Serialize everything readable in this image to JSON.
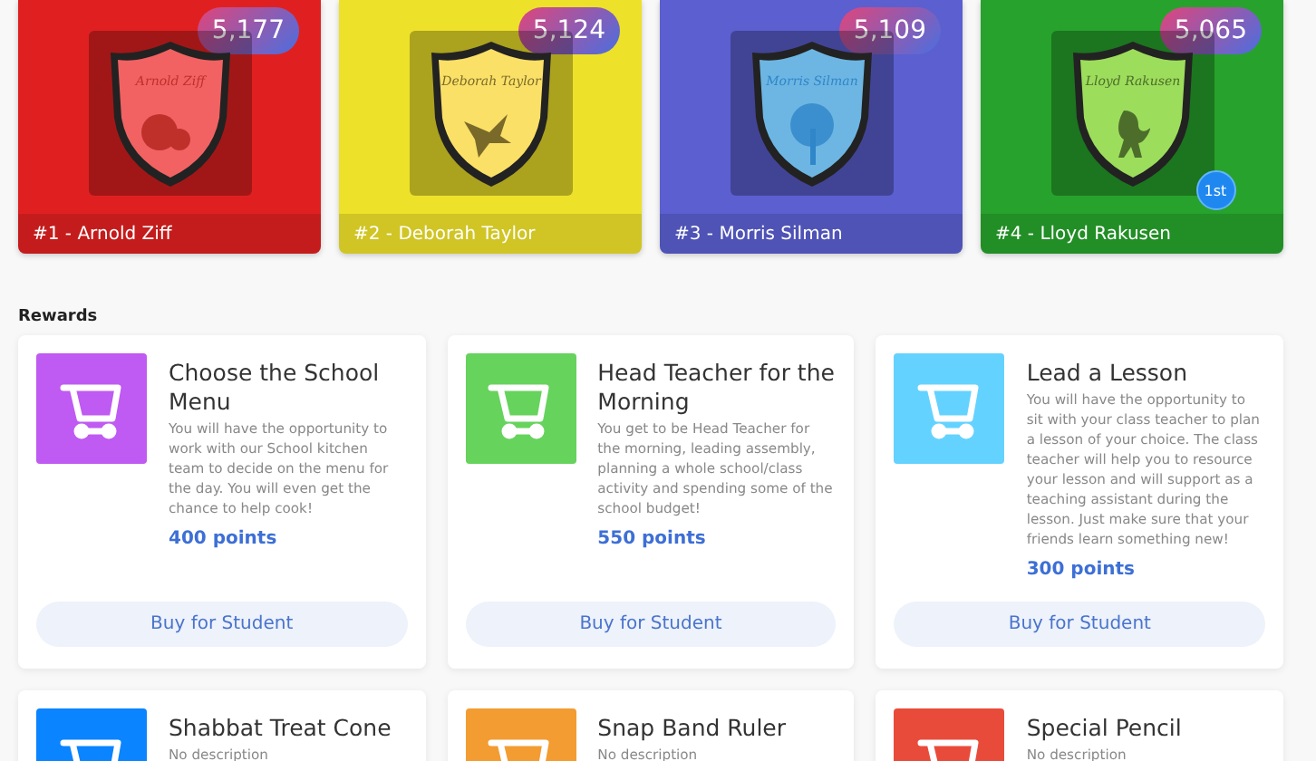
{
  "houses": [
    {
      "rank_label": "#1 - Arnold Ziff",
      "crest_name": "Arnold Ziff",
      "score": "5,177",
      "color": "#e02020",
      "kind": "fruit"
    },
    {
      "rank_label": "#2 - Deborah Taylor",
      "crest_name": "Deborah Taylor",
      "score": "5,124",
      "color": "#ede12a",
      "kind": "bird"
    },
    {
      "rank_label": "#3 - Morris Silman",
      "crest_name": "Morris Silman",
      "score": "5,109",
      "color": "#5b5fcf",
      "kind": "tree"
    },
    {
      "rank_label": "#4 - Lloyd Rakusen",
      "crest_name": "Lloyd Rakusen",
      "score": "5,065",
      "color": "#27a22c",
      "kind": "lion",
      "ribbon": "1st"
    }
  ],
  "rewards_heading": "Rewards",
  "rewards": [
    {
      "title": "Choose the School Menu",
      "description": "You will have the opportunity to work with our School kitchen team to decide on the menu for the day. You will even get the chance to help cook!",
      "points": "400 points",
      "button": "Buy for Student",
      "color": "#bf5af2"
    },
    {
      "title": "Head Teacher for the Morning",
      "description": "You get to be Head Teacher for the morning, leading assembly, planning a whole school/class activity and spending some of the school budget!",
      "points": "550 points",
      "button": "Buy for Student",
      "color": "#66d35d"
    },
    {
      "title": "Lead a Lesson",
      "description": "You will have the opportunity to sit with your class teacher to plan a lesson of your choice. The class teacher will help you to resource your lesson and will support as a teaching assistant during the lesson. Just make sure that your friends learn something new!",
      "points": "300 points",
      "button": "Buy for Student",
      "color": "#64d2ff"
    },
    {
      "title": "Shabbat Treat Cone",
      "description": "No description",
      "color": "#0a84ff"
    },
    {
      "title": "Snap Band Ruler",
      "description": "No description",
      "color": "#f39c32"
    },
    {
      "title": "Special Pencil",
      "description": "No description",
      "color": "#e94b3a"
    }
  ]
}
